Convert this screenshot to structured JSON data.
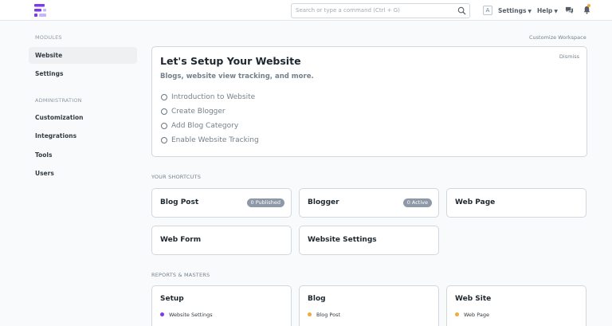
{
  "navbar": {
    "search_placeholder": "Search or type a command (Ctrl + G)",
    "avatar_initial": "A",
    "settings_label": "Settings",
    "help_label": "Help",
    "brand_color": "#7c3aed"
  },
  "sidebar": {
    "modules_heading": "MODULES",
    "modules": [
      {
        "label": "Website",
        "active": true
      },
      {
        "label": "Settings",
        "active": false
      }
    ],
    "admin_heading": "ADMINISTRATION",
    "admin": [
      {
        "label": "Customization"
      },
      {
        "label": "Integrations"
      },
      {
        "label": "Tools"
      },
      {
        "label": "Users"
      }
    ]
  },
  "main": {
    "customize_label": "Customize Workspace",
    "onboarding": {
      "title": "Let's Setup Your Website",
      "subtitle": "Blogs, website view tracking, and more.",
      "dismiss_label": "Dismiss",
      "steps": [
        "Introduction to Website",
        "Create Blogger",
        "Add Blog Category",
        "Enable Website Tracking"
      ]
    },
    "shortcuts_heading": "YOUR SHORTCUTS",
    "shortcuts": [
      {
        "label": "Blog Post",
        "badge": "0 Published"
      },
      {
        "label": "Blogger",
        "badge": "0 Active"
      },
      {
        "label": "Web Page",
        "badge": ""
      },
      {
        "label": "Web Form",
        "badge": ""
      },
      {
        "label": "Website Settings",
        "badge": ""
      }
    ],
    "reports_heading": "REPORTS & MASTERS",
    "reports": [
      {
        "title": "Setup",
        "links": [
          "Website Settings"
        ],
        "dot_color": "#7c3aed"
      },
      {
        "title": "Blog",
        "links": [
          "Blog Post"
        ],
        "dot_color": "#f2a93b"
      },
      {
        "title": "Web Site",
        "links": [
          "Web Page"
        ],
        "dot_color": "#f2a93b"
      }
    ]
  }
}
